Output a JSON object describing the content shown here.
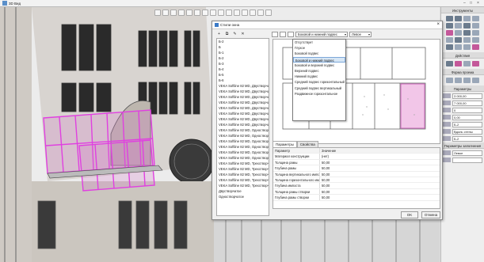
{
  "app": {
    "title": "3D Вид"
  },
  "toolbar": {
    "buttons": [
      "new",
      "open",
      "save",
      "print",
      "cut",
      "copy",
      "paste",
      "undo",
      "redo",
      "select",
      "move",
      "rotate",
      "view",
      "render",
      "help"
    ]
  },
  "right_panel": {
    "tools_title": "Инструменты",
    "actions_title": "Действия",
    "form_title": "Форма проема",
    "params_title": "Параметры",
    "fill_title": "Параметры заполнения",
    "values": [
      "3 000,00",
      "7 000,00",
      "0",
      "0,00",
      "Б-2",
      "Вдоль стены",
      "Б-2"
    ],
    "fill_values": [
      "Левое",
      ""
    ]
  },
  "dialog": {
    "title": "Стили окна",
    "list_items": [
      "Б-2",
      "Б",
      "Б-1",
      "Б-2",
      "Б-3",
      "Б-4",
      "Б-5",
      "Б-6",
      "VEKA Softline 82 MD, Двустворчатое",
      "VEKA Softline 82 MD, Двустворчатое",
      "VEKA Softline 82 MD, Двустворчатое",
      "VEKA Softline 82 MD, Двустворчатое",
      "VEKA Softline 82 MD, Двустворчатое",
      "VEKA Softline 82 MD, Двустворчатое",
      "VEKA Softline 82 MD, Двустворчатое",
      "VEKA Softline 82 MD, Двустворчатое",
      "VEKA Softline 82 MD, Одностворчатое",
      "VEKA Softline 82 MD, Одностворчатое",
      "VEKA Softline 82 MD, Одностворчатое",
      "VEKA Softline 82 MD, Одностворчатое",
      "VEKA Softline 82 MD, Одностворчатое",
      "VEKA Softline 82 MD, Одностворчатое",
      "VEKA Softline 82 MD, Трехстворчатое",
      "VEKA Softline 82 MD, Трехстворчатое",
      "VEKA Softline 82 MD, Трехстворчатое",
      "VEKA Softline 82 MD, Трехстворчатое",
      "VEKA Softline 82 MD, Трехстворчатое",
      "Двустворчатое",
      "Одностворчатое"
    ],
    "combo_value": "Боковой и нижний подвес",
    "combo2_value": "Левое",
    "dropdown": [
      "Отсутствует",
      "Глухое",
      "Боковой подвес",
      "Боковой и нижний подвес",
      "Боковой и верхний подвес",
      "Верхний подвес",
      "Нижний подвес",
      "Средний подвес горизонтальный",
      "Средний подвес вертикальный",
      "Раздвижное горизонтальное"
    ],
    "tabs": [
      "Параметры",
      "Свойства"
    ],
    "table_headers": [
      "Параметр",
      "Значение"
    ],
    "table_rows": [
      [
        "Материал конструкции",
        "(нет)"
      ],
      [
        "Толщина рамы",
        "50,00"
      ],
      [
        "Глубина рамы",
        "50,00"
      ],
      [
        "Толщина вертикального импоста",
        "50,00"
      ],
      [
        "Толщина горизонтального импоста",
        "50,00"
      ],
      [
        "Глубина импоста",
        "50,00"
      ],
      [
        "Толщина рамы створки",
        "50,00"
      ],
      [
        "Глубина рамы створки",
        "50,00"
      ]
    ],
    "ok_label": "OK",
    "cancel_label": "Отмена"
  },
  "colors": {
    "selection": "#e040e0",
    "accent": "#3b7ac7"
  }
}
